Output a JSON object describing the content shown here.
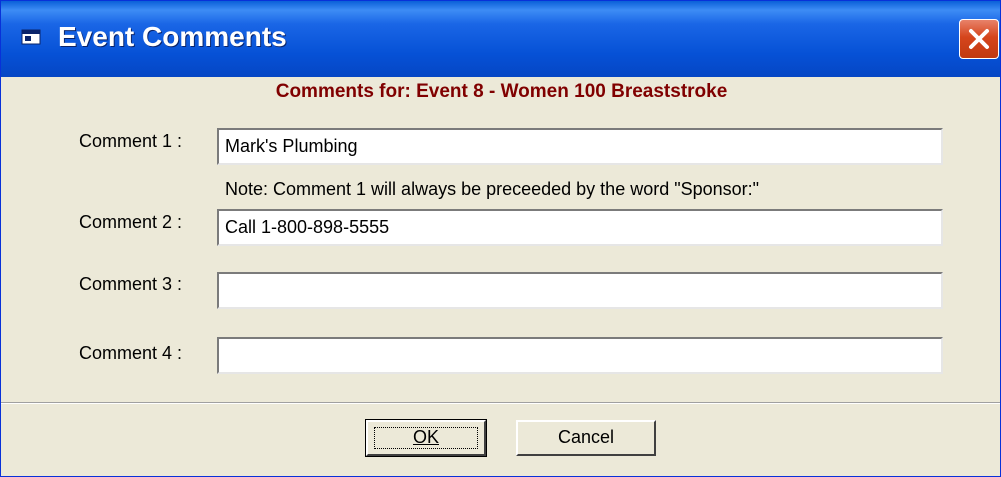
{
  "window": {
    "title": "Event Comments"
  },
  "heading": "Comments for: Event 8 - Women 100 Breaststroke",
  "fields": [
    {
      "label": "Comment 1 :",
      "value": "Mark's Plumbing"
    },
    {
      "label": "Comment 2 :",
      "value": "Call 1-800-898-5555"
    },
    {
      "label": "Comment 3 :",
      "value": ""
    },
    {
      "label": "Comment 4 :",
      "value": ""
    }
  ],
  "note": "Note:  Comment 1 will always be preceeded by the word \"Sponsor:\"",
  "buttons": {
    "ok": "OK",
    "cancel": "Cancel"
  },
  "colors": {
    "titlebar": "#0651d6",
    "heading": "#800000",
    "dialog_bg": "#ece9d8",
    "close_button": "#d5451c"
  },
  "icons": {
    "title": "window-app-icon",
    "close": "close-icon"
  }
}
